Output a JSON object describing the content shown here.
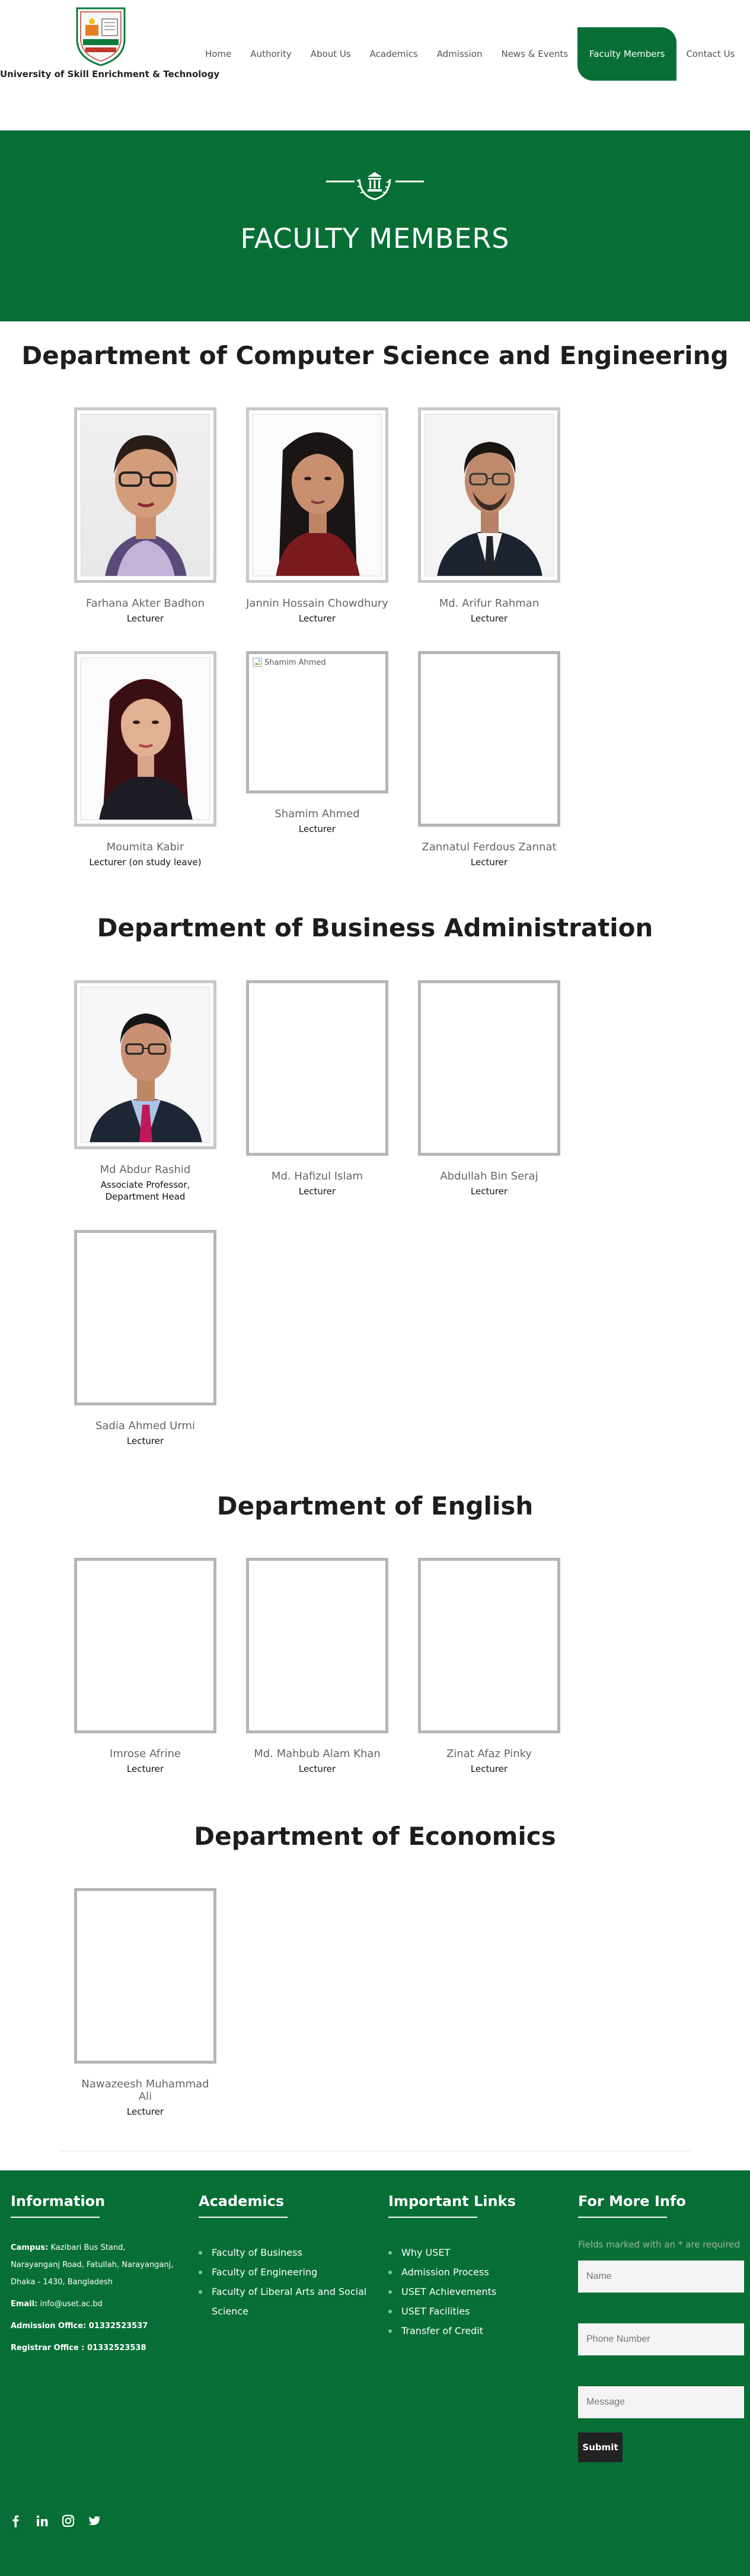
{
  "site": {
    "name": "University of Skill Enrichment & Technology"
  },
  "nav": [
    {
      "label": "Home"
    },
    {
      "label": "Authority"
    },
    {
      "label": "About Us"
    },
    {
      "label": "Academics"
    },
    {
      "label": "Admission"
    },
    {
      "label": "News & Events"
    },
    {
      "label": "Faculty Members",
      "active": true
    },
    {
      "label": "Contact Us"
    }
  ],
  "hero": {
    "title": "FACULTY MEMBERS"
  },
  "departments": [
    {
      "name": "Department of Computer Science and Engineering",
      "members": [
        {
          "name": "Farhana Akter Badhon",
          "title": "Lecturer"
        },
        {
          "name": "Jannin Hossain Chowdhury",
          "title": "Lecturer"
        },
        {
          "name": "Md. Arifur Rahman",
          "title": "Lecturer"
        },
        {
          "name": "Moumita Kabir",
          "title": "Lecturer (on study leave)"
        },
        {
          "name": "Shamim Ahmed",
          "title": "Lecturer",
          "alt": "Shamim Ahmed"
        },
        {
          "name": "Zannatul Ferdous Zannat",
          "title": "Lecturer"
        }
      ]
    },
    {
      "name": "Department of Business Administration",
      "members": [
        {
          "name": "Md Abdur Rashid",
          "title": "Associate Professor, Department Head"
        },
        {
          "name": "Md. Hafizul Islam",
          "title": "Lecturer"
        },
        {
          "name": "Abdullah Bin Seraj",
          "title": "Lecturer"
        },
        {
          "name": "Sadia Ahmed Urmi",
          "title": "Lecturer"
        }
      ]
    },
    {
      "name": "Department of English",
      "members": [
        {
          "name": "Imrose Afrine",
          "title": "Lecturer"
        },
        {
          "name": "Md. Mahbub Alam Khan",
          "title": "Lecturer"
        },
        {
          "name": "Zinat Afaz Pinky",
          "title": "Lecturer"
        }
      ]
    },
    {
      "name": "Department of Economics",
      "members": [
        {
          "name": "Nawazeesh Muhammad Ali",
          "title": "Lecturer"
        }
      ]
    }
  ],
  "footer": {
    "information": {
      "heading": "Information",
      "campus_label": "Campus:",
      "campus_text": "Kazibari Bus Stand, Narayanganj Road, Fatullah, Narayanganj, Dhaka - 1430, Bangladesh",
      "email_label": "Email:",
      "email_text": "info@uset.ac.bd",
      "admission": "Admission Office: 01332523537",
      "registrar": "Registrar Office : 01332523538"
    },
    "academics": {
      "heading": "Academics",
      "links": [
        "Faculty of Business",
        "Faculty of Engineering",
        "Faculty of Liberal Arts and Social Science"
      ]
    },
    "important": {
      "heading": "Important Links",
      "links": [
        "Why USET",
        "Admission Process",
        "USET Achievements",
        "USET Facilities",
        "Transfer of Credit"
      ]
    },
    "more": {
      "heading": "For More Info",
      "note": "Fields marked with an * are required",
      "name_placeholder": "Name",
      "phone_placeholder": "Phone Number",
      "message_placeholder": "Message",
      "submit": "Submit"
    }
  },
  "colors": {
    "brand_green": "#076f36",
    "text_dark": "#1d1d1d"
  },
  "icons": [
    "facebook-icon",
    "linkedin-icon",
    "instagram-icon",
    "twitter-icon"
  ]
}
